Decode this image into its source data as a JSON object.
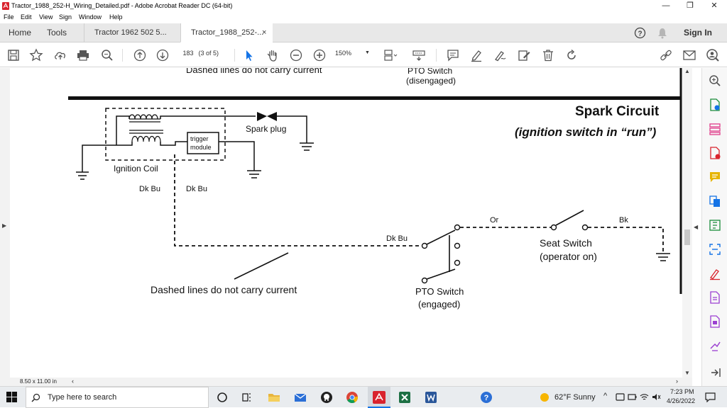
{
  "window": {
    "title": "Tractor_1988_252-H_Wiring_Detailed.pdf - Adobe Acrobat Reader DC (64-bit)",
    "minimize": "—",
    "maximize": "❐",
    "close": "✕"
  },
  "menu": [
    "File",
    "Edit",
    "View",
    "Sign",
    "Window",
    "Help"
  ],
  "tabs": {
    "home": "Home",
    "tools": "Tools",
    "doc1": "Tractor 1962 502 5...",
    "doc2": "Tractor_1988_252-...",
    "close": "×",
    "sign_in": "Sign In"
  },
  "toolbar": {
    "page_number": "183",
    "page_of": "(3 of 5)",
    "zoom": "150%"
  },
  "diagram": {
    "top_note": "Dashed lines do not carry current",
    "top_pto_line1": "PTO Switch",
    "top_pto_line2": "(disengaged)",
    "heading": "Spark Circuit",
    "subheading": "(ignition switch in “run”)",
    "spark_plug": "Spark plug",
    "trigger_line1": "trigger",
    "trigger_line2": "module",
    "ignition_coil": "Ignition Coil",
    "wire_left": "Dk Bu",
    "wire_right": "Dk Bu",
    "wire_bottom": "Dk Bu",
    "wire_orange": "Or",
    "wire_black": "Bk",
    "seat_line1": "Seat Switch",
    "seat_line2": "(operator on)",
    "bottom_note": "Dashed lines do not carry current",
    "pto_line1": "PTO Switch",
    "pto_line2": "(engaged)"
  },
  "status": {
    "page_size": "8.50 x 11.00 in"
  },
  "taskbar": {
    "search_placeholder": "Type here to search",
    "weather": "62°F  Sunny",
    "time": "7:23 PM",
    "date": "4/26/2022"
  },
  "colors": {
    "acrobat_red": "#d9232d",
    "accent_blue": "#1473e6",
    "right_panel_icons": [
      "#1473e6",
      "#1a8c3a",
      "#e03c8a",
      "#d9232d",
      "#e6b400",
      "#1473e6",
      "#1a8c3a",
      "#1473e6",
      "#d9232d",
      "#9b3fd1",
      "#9b3fd1",
      "#9b3fd1"
    ]
  }
}
